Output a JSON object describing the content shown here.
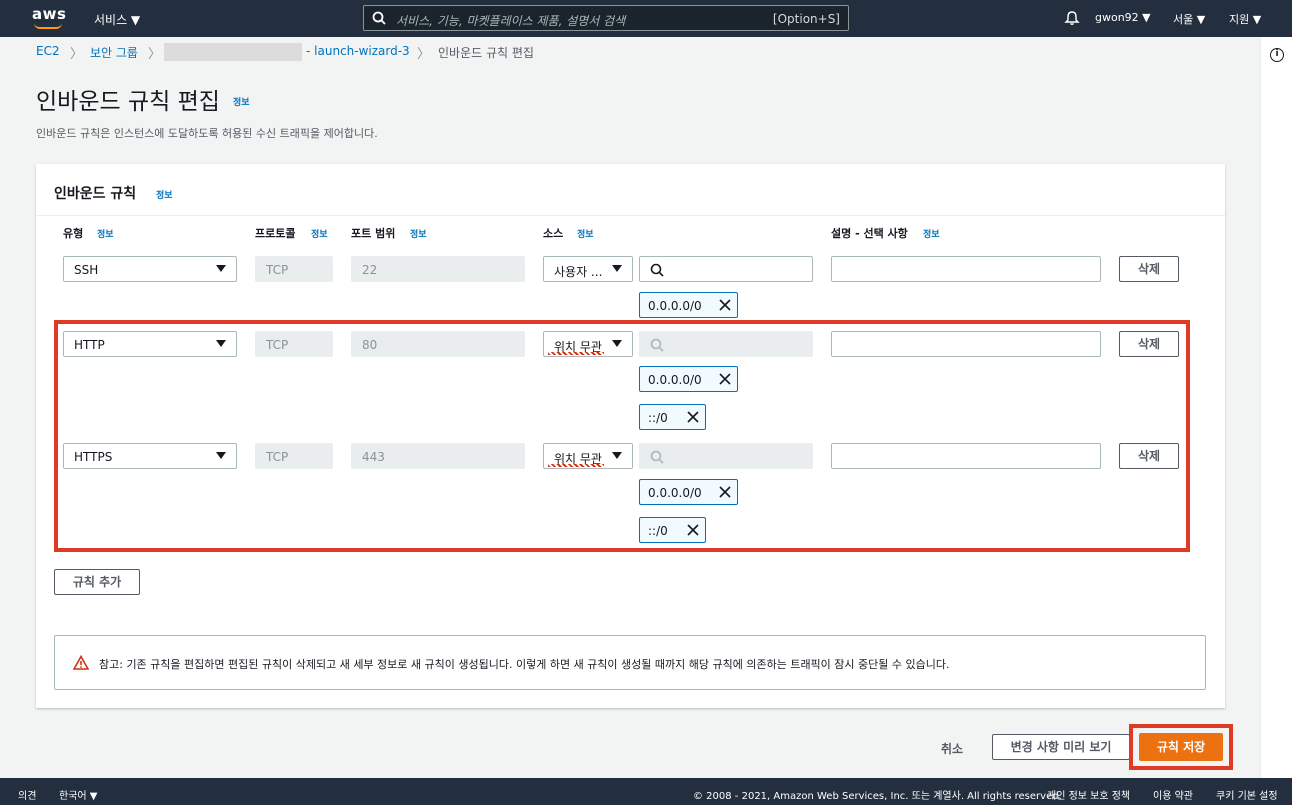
{
  "topnav": {
    "logo": "aws",
    "services_label": "서비스 ▼",
    "search_placeholder": "서비스, 기능, 마켓플레이스 제품, 설명서 검색",
    "search_shortcut": "[Option+S]",
    "user": "gwon92 ▼",
    "region": "서울 ▼",
    "support": "지원 ▼"
  },
  "breadcrumb": {
    "ec2": "EC2",
    "security_groups": "보안 그룹",
    "sg_name": "- launch-wizard-3",
    "current": "인바운드 규칙 편집"
  },
  "page": {
    "title": "인바운드 규칙 편집",
    "info": "정보",
    "description": "인바운드 규칙은 인스턴스에 도달하도록 허용된 수신 트래픽을 제어합니다."
  },
  "panel": {
    "title": "인바운드 규칙",
    "info": "정보",
    "columns": {
      "type": "유형",
      "protocol": "프로토콜",
      "port_range": "포트 범위",
      "source": "소스",
      "description": "설명 - 선택 사항",
      "info": "정보"
    },
    "rules": [
      {
        "type": "SSH",
        "protocol": "TCP",
        "port": "22",
        "source": "사용자 ...",
        "tokens": [
          "0.0.0.0/0"
        ],
        "delete": "삭제"
      },
      {
        "type": "HTTP",
        "protocol": "TCP",
        "port": "80",
        "source": "위치 무관",
        "tokens": [
          "0.0.0.0/0",
          "::/0"
        ],
        "delete": "삭제"
      },
      {
        "type": "HTTPS",
        "protocol": "TCP",
        "port": "443",
        "source": "위치 무관",
        "tokens": [
          "0.0.0.0/0",
          "::/0"
        ],
        "delete": "삭제"
      }
    ],
    "add_rule": "규칙 추가",
    "warning": "참고: 기존 규칙을 편집하면 편집된 규칙이 삭제되고 새 세부 정보로 새 규칙이 생성됩니다. 이렇게 하면 새 규칙이 생성될 때까지 해당 규칙에 의존하는 트래픽이 잠시 중단될 수 있습니다."
  },
  "actions": {
    "cancel": "취소",
    "preview": "변경 사항 미리 보기",
    "save": "규칙 저장"
  },
  "footer": {
    "feedback": "의견",
    "language": "한국어 ▼",
    "copyright": "© 2008 - 2021, Amazon Web Services, Inc. 또는 계열사. All rights reserved.",
    "privacy": "개인 정보 보호 정책",
    "terms": "이용 약관",
    "cookies": "쿠키 기본 설정"
  },
  "colors": {
    "nav_bg": "#232f3e",
    "link": "#0073bb",
    "primary": "#ec7211",
    "highlight": "#df3a26"
  }
}
